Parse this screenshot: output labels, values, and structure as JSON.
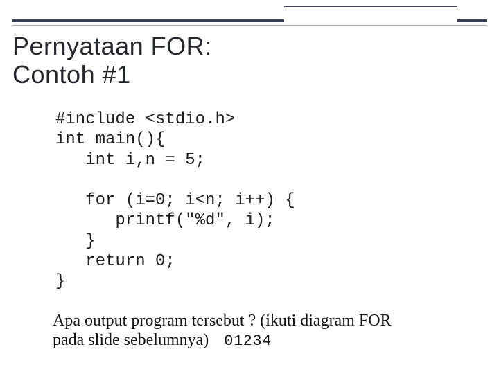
{
  "title": {
    "line1": "Pernyataan FOR:",
    "line2": "Contoh #1"
  },
  "code": {
    "line1": "#include <stdio.h>",
    "line2": "int main(){",
    "line3": "   int i,n = 5;",
    "line4": "",
    "line5": "   for (i=0; i<n; i++) {",
    "line6": "      printf(\"%d\", i);",
    "line7": "   }",
    "line8": "   return 0;",
    "line9": "}"
  },
  "question": {
    "text_part1": "Apa output program tersebut ? (ikuti diagram FOR",
    "text_part2": "pada slide sebelumnya)",
    "answer": "01234"
  }
}
